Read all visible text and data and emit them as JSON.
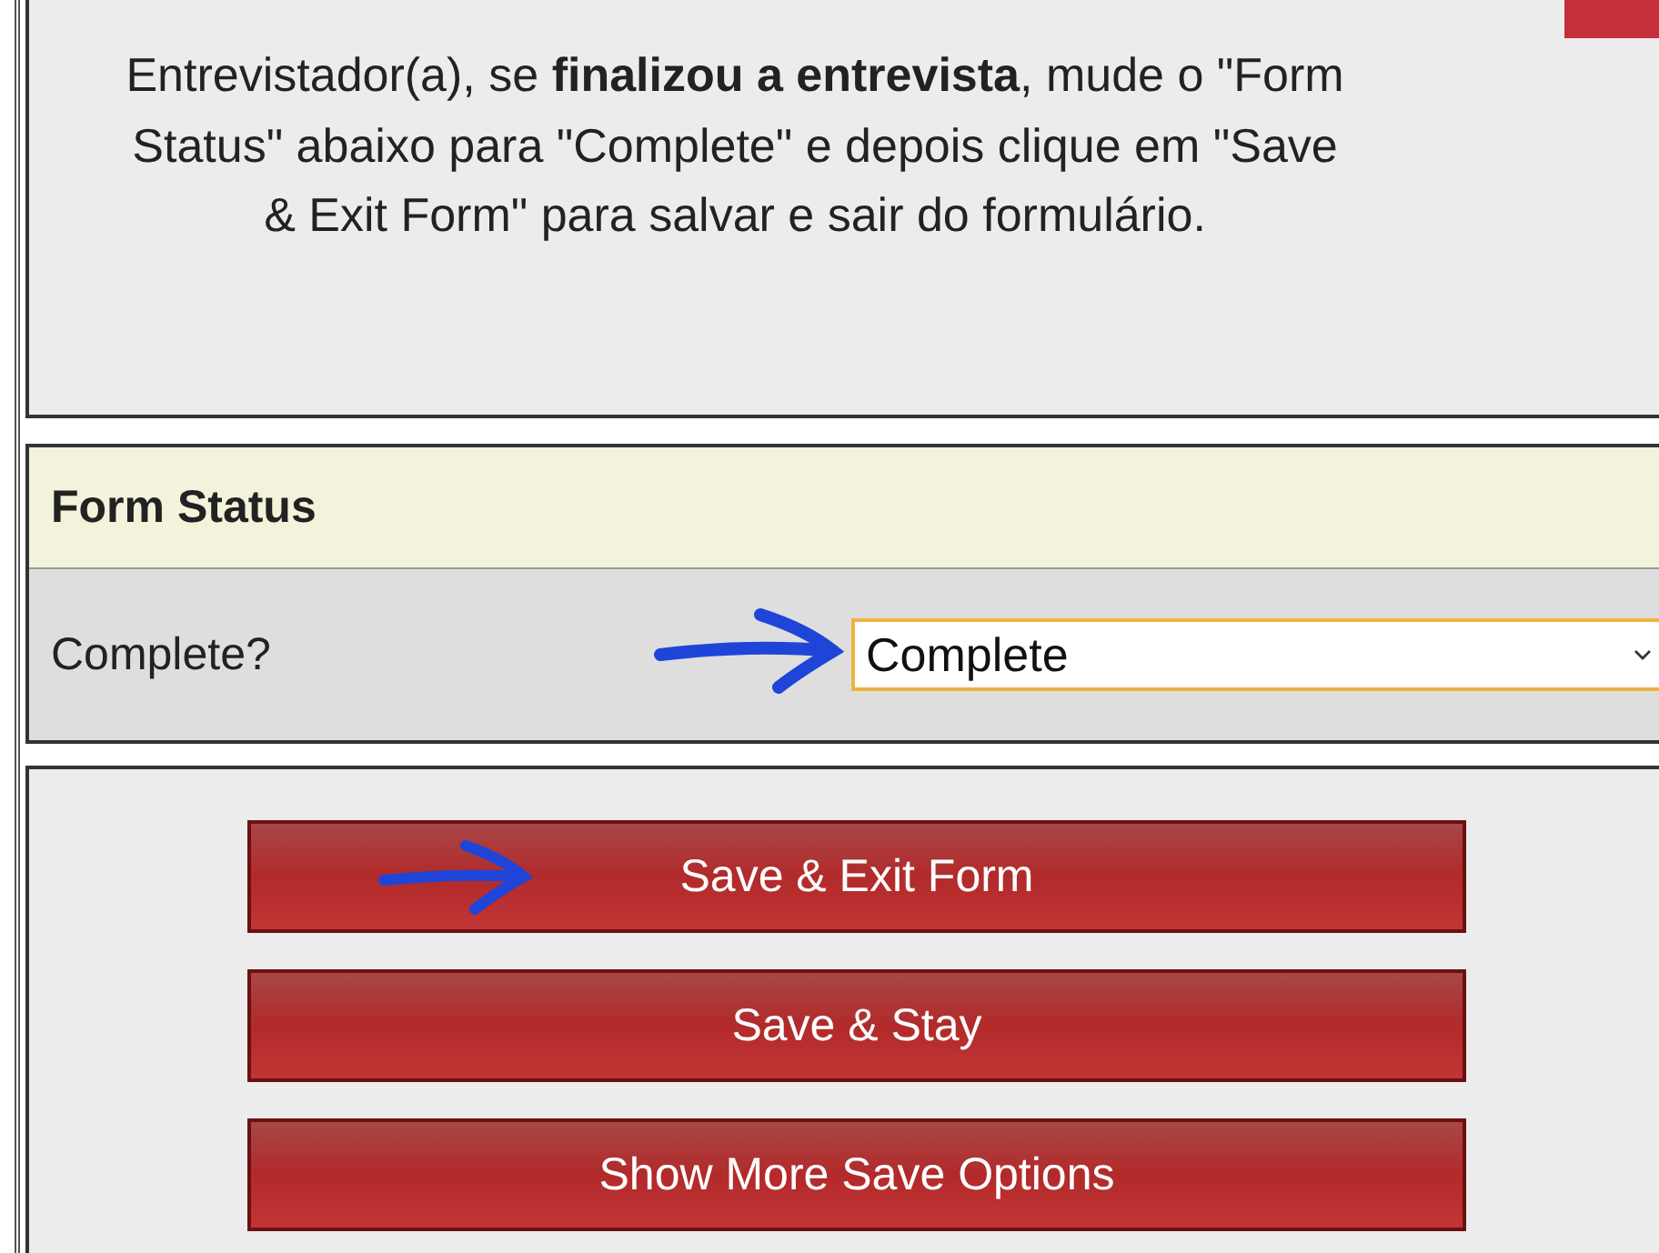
{
  "instructions": "Entrevistador(a), se **finalizou a entrevista**, mude o \"Form Status\" abaixo para \"Complete\" e depois clique em \"Save & Exit Form\" para salvar e sair do formulário.",
  "form_status": {
    "title": "Form Status",
    "field_label": "Complete?",
    "value": "Complete"
  },
  "buttons": [
    "Save & Exit Form",
    "Save & Stay",
    "Show More Save Options"
  ]
}
